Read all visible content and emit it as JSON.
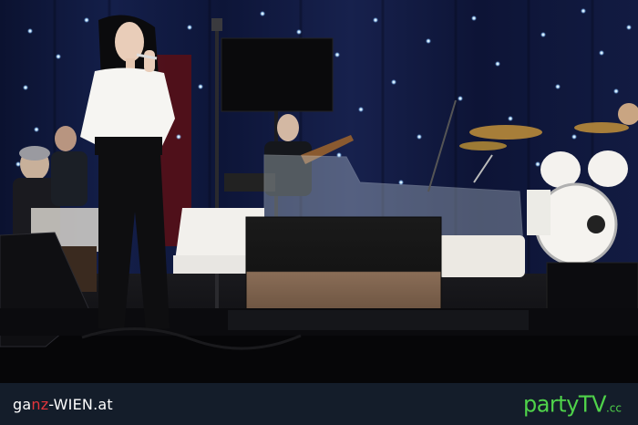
{
  "footer": {
    "left_logo": {
      "part1": "ga",
      "part2": "nz",
      "part3": "-WIEN.at"
    },
    "right_logo": {
      "main": "partyTV",
      "suffix": ".cc"
    }
  },
  "colors": {
    "footer_bg": "#141d2a",
    "logo_left_text": "#ffffff",
    "logo_left_accent": "#e3353b",
    "logo_right": "#4fd24a"
  }
}
